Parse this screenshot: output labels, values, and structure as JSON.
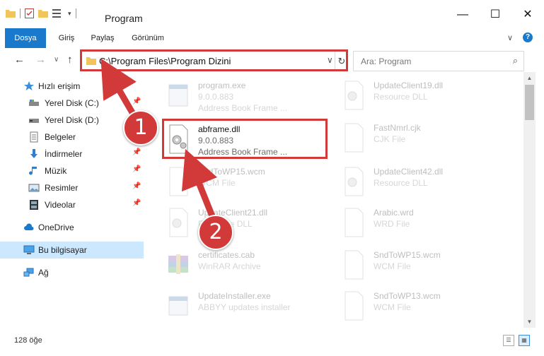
{
  "window": {
    "title": "Program",
    "controls": {
      "minimize": "—",
      "maximize": "☐",
      "close": "✕"
    }
  },
  "ribbon": {
    "tabs": [
      {
        "label": "Dosya"
      },
      {
        "label": "Giriş"
      },
      {
        "label": "Paylaş"
      },
      {
        "label": "Görünüm"
      }
    ],
    "expand": "∨",
    "help": "?"
  },
  "nav": {
    "back": "←",
    "forward": "→",
    "recent": "∨",
    "up": "↑"
  },
  "address": {
    "path": "C:\\Program Files\\Program Dizini",
    "dropdown": "∨",
    "refresh": "↻"
  },
  "search": {
    "placeholder": "Ara: Program",
    "icon": "⌕"
  },
  "sidebar": {
    "quick_access": "Hızlı erişim",
    "items": [
      {
        "label": "Yerel Disk (C:)",
        "pinned": true
      },
      {
        "label": "Yerel Disk (D:)",
        "pinned": false
      },
      {
        "label": "Belgeler",
        "pinned": true
      },
      {
        "label": "İndirmeler",
        "pinned": true
      },
      {
        "label": "Müzik",
        "pinned": true
      },
      {
        "label": "Resimler",
        "pinned": true
      },
      {
        "label": "Videolar",
        "pinned": true
      }
    ],
    "onedrive": "OneDrive",
    "this_pc": "Bu bilgisayar",
    "network": "Ağ"
  },
  "files": {
    "left": [
      {
        "name": "program.exe",
        "sub1": "9.0.0.883",
        "sub2": "Address Book Frame ..."
      },
      {
        "name": "abframe.dll",
        "sub1": "9.0.0.883",
        "sub2": "Address Book Frame ..."
      },
      {
        "name": "SndToWP15.wcm",
        "sub1": "WCM File",
        "sub2": ""
      },
      {
        "name": "UpdateClient21.dll",
        "sub1": "Resource DLL",
        "sub2": ""
      },
      {
        "name": "certificates.cab",
        "sub1": "WinRAR Archive",
        "sub2": ""
      },
      {
        "name": "UpdateInstaller.exe",
        "sub1": "ABBYY updates installer",
        "sub2": ""
      }
    ],
    "right": [
      {
        "name": "UpdateClient19.dll",
        "sub1": "Resource DLL"
      },
      {
        "name": "FastNmrl.cjk",
        "sub1": "CJK File"
      },
      {
        "name": "UpdateClient42.dll",
        "sub1": "Resource DLL"
      },
      {
        "name": "Arabic.wrd",
        "sub1": "WRD File"
      },
      {
        "name": "SndToWP15.wcm",
        "sub1": "WCM File"
      },
      {
        "name": "SndToWP13.wcm",
        "sub1": "WCM File"
      }
    ]
  },
  "status": {
    "count": "128 öğe"
  },
  "annotations": {
    "step1": "1",
    "step2": "2",
    "color": "#d23a3a"
  },
  "colors": {
    "accent": "#1979ca",
    "selection": "#cce8ff"
  }
}
